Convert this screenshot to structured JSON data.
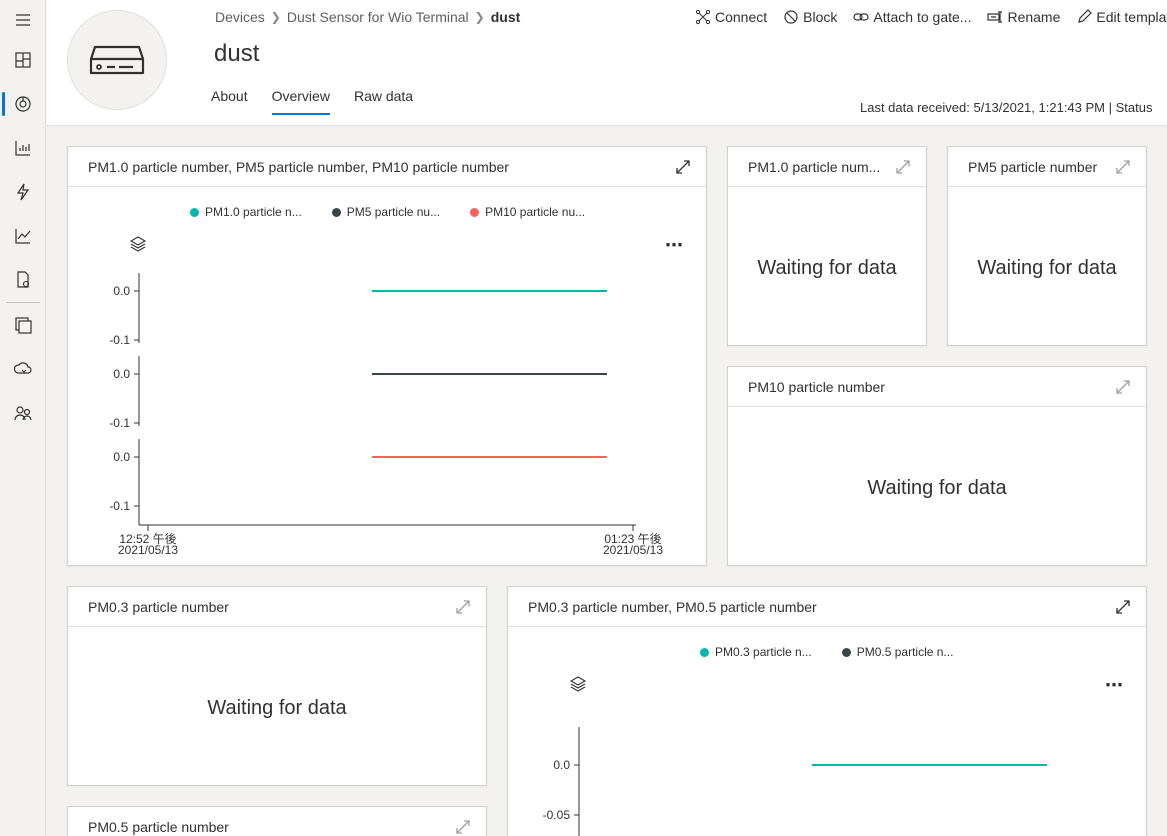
{
  "breadcrumb": {
    "devices": "Devices",
    "template": "Dust Sensor for Wio Terminal",
    "device": "dust"
  },
  "page_title": "dust",
  "tabs": [
    {
      "label": "About"
    },
    {
      "label": "Overview"
    },
    {
      "label": "Raw data"
    }
  ],
  "commands": {
    "connect": "Connect",
    "block": "Block",
    "attach": "Attach to gate...",
    "rename": "Rename",
    "edit_template": "Edit template"
  },
  "status": "Last data received: 5/13/2021, 1:21:43 PM  |  Status",
  "waiting_text": "Waiting for data",
  "tiles": {
    "combo1": {
      "title": "PM1.0 particle number, PM5 particle number, PM10 particle number",
      "legend": [
        "PM1.0 particle n...",
        "PM5 particle nu...",
        "PM10 particle nu..."
      ]
    },
    "pm10_small": {
      "title": "PM1.0 particle num..."
    },
    "pm5": {
      "title": "PM5 particle number"
    },
    "pm10": {
      "title": "PM10 particle number"
    },
    "pm03": {
      "title": "PM0.3 particle number"
    },
    "combo2": {
      "title": "PM0.3 particle number, PM0.5 particle number",
      "legend": [
        "PM0.3 particle n...",
        "PM0.5 particle n..."
      ]
    },
    "pm05": {
      "title": "PM0.5 particle number"
    }
  },
  "colors": {
    "accent": "#0078d4",
    "series1": "#01b8aa",
    "series2": "#374649",
    "series3": "#fd625e"
  },
  "chart_data": [
    {
      "type": "line",
      "series": [
        {
          "name": "PM1.0 particle n...",
          "values": [
            0.0,
            0.0
          ],
          "yticks": [
            "0.0",
            "-0.1"
          ]
        },
        {
          "name": "PM5 particle nu...",
          "values": [
            0.0,
            0.0
          ],
          "yticks": [
            "0.0",
            "-0.1"
          ]
        },
        {
          "name": "PM10 particle nu...",
          "values": [
            0.0,
            0.0
          ],
          "yticks": [
            "0.0",
            "-0.1"
          ]
        }
      ],
      "x": [
        "2021-05-13 13:08",
        "2021-05-13 13:23"
      ],
      "xticks": [
        {
          "time": "12:52 午後",
          "date": "2021/05/13"
        },
        {
          "time": "01:23 午後",
          "date": "2021/05/13"
        }
      ],
      "xlim": [
        "2021-05-13 12:52",
        "2021-05-13 13:23"
      ],
      "ylim": [
        -0.1,
        0.0
      ]
    },
    {
      "type": "line",
      "series": [
        {
          "name": "PM0.3 particle n...",
          "values": [
            0.0,
            0.0
          ]
        }
      ],
      "yticks": [
        "0.0",
        "-0.05"
      ],
      "ylim": [
        -0.05,
        0.0
      ]
    }
  ]
}
